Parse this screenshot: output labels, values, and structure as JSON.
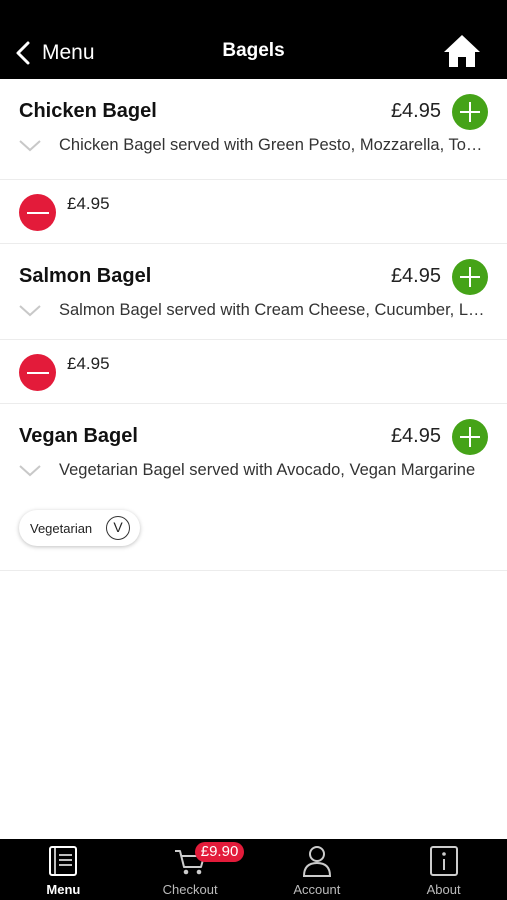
{
  "header": {
    "back_label": "Menu",
    "title": "Bagels"
  },
  "items": [
    {
      "name": "Chicken Bagel",
      "price": "£4.95",
      "description": "Chicken Bagel served with Green Pesto, Mozzarella, Tomato",
      "in_basket_price": "£4.95"
    },
    {
      "name": "Salmon Bagel",
      "price": "£4.95",
      "description": "Salmon Bagel served with Cream Cheese, Cucumber, Lettuce",
      "in_basket_price": "£4.95"
    },
    {
      "name": "Vegan Bagel",
      "price": "£4.95",
      "description": "Vegetarian Bagel served with Avocado, Vegan Margarine",
      "tag_label": "Vegetarian",
      "tag_symbol": "V"
    }
  ],
  "tabbar": {
    "menu_label": "Menu",
    "checkout_label": "Checkout",
    "checkout_badge": "£9.90",
    "account_label": "Account",
    "about_label": "About"
  },
  "colors": {
    "header_bg": "#000000",
    "add_green": "#45a318",
    "remove_red": "#e31b3a"
  },
  "icons": [
    "back-chevron-icon",
    "home-icon",
    "add-icon",
    "remove-icon",
    "expand-chevron-icon",
    "menu-book-icon",
    "cart-icon",
    "account-icon",
    "info-icon"
  ]
}
